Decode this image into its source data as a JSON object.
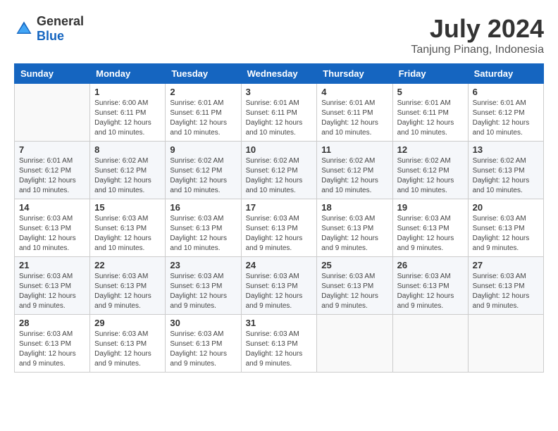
{
  "logo": {
    "text_general": "General",
    "text_blue": "Blue"
  },
  "title": "July 2024",
  "subtitle": "Tanjung Pinang, Indonesia",
  "days_of_week": [
    "Sunday",
    "Monday",
    "Tuesday",
    "Wednesday",
    "Thursday",
    "Friday",
    "Saturday"
  ],
  "weeks": [
    [
      {
        "day": "",
        "sunrise": "",
        "sunset": "",
        "daylight": ""
      },
      {
        "day": "1",
        "sunrise": "Sunrise: 6:00 AM",
        "sunset": "Sunset: 6:11 PM",
        "daylight": "Daylight: 12 hours and 10 minutes."
      },
      {
        "day": "2",
        "sunrise": "Sunrise: 6:01 AM",
        "sunset": "Sunset: 6:11 PM",
        "daylight": "Daylight: 12 hours and 10 minutes."
      },
      {
        "day": "3",
        "sunrise": "Sunrise: 6:01 AM",
        "sunset": "Sunset: 6:11 PM",
        "daylight": "Daylight: 12 hours and 10 minutes."
      },
      {
        "day": "4",
        "sunrise": "Sunrise: 6:01 AM",
        "sunset": "Sunset: 6:11 PM",
        "daylight": "Daylight: 12 hours and 10 minutes."
      },
      {
        "day": "5",
        "sunrise": "Sunrise: 6:01 AM",
        "sunset": "Sunset: 6:11 PM",
        "daylight": "Daylight: 12 hours and 10 minutes."
      },
      {
        "day": "6",
        "sunrise": "Sunrise: 6:01 AM",
        "sunset": "Sunset: 6:12 PM",
        "daylight": "Daylight: 12 hours and 10 minutes."
      }
    ],
    [
      {
        "day": "7",
        "sunrise": "Sunrise: 6:01 AM",
        "sunset": "Sunset: 6:12 PM",
        "daylight": "Daylight: 12 hours and 10 minutes."
      },
      {
        "day": "8",
        "sunrise": "Sunrise: 6:02 AM",
        "sunset": "Sunset: 6:12 PM",
        "daylight": "Daylight: 12 hours and 10 minutes."
      },
      {
        "day": "9",
        "sunrise": "Sunrise: 6:02 AM",
        "sunset": "Sunset: 6:12 PM",
        "daylight": "Daylight: 12 hours and 10 minutes."
      },
      {
        "day": "10",
        "sunrise": "Sunrise: 6:02 AM",
        "sunset": "Sunset: 6:12 PM",
        "daylight": "Daylight: 12 hours and 10 minutes."
      },
      {
        "day": "11",
        "sunrise": "Sunrise: 6:02 AM",
        "sunset": "Sunset: 6:12 PM",
        "daylight": "Daylight: 12 hours and 10 minutes."
      },
      {
        "day": "12",
        "sunrise": "Sunrise: 6:02 AM",
        "sunset": "Sunset: 6:12 PM",
        "daylight": "Daylight: 12 hours and 10 minutes."
      },
      {
        "day": "13",
        "sunrise": "Sunrise: 6:02 AM",
        "sunset": "Sunset: 6:13 PM",
        "daylight": "Daylight: 12 hours and 10 minutes."
      }
    ],
    [
      {
        "day": "14",
        "sunrise": "Sunrise: 6:03 AM",
        "sunset": "Sunset: 6:13 PM",
        "daylight": "Daylight: 12 hours and 10 minutes."
      },
      {
        "day": "15",
        "sunrise": "Sunrise: 6:03 AM",
        "sunset": "Sunset: 6:13 PM",
        "daylight": "Daylight: 12 hours and 10 minutes."
      },
      {
        "day": "16",
        "sunrise": "Sunrise: 6:03 AM",
        "sunset": "Sunset: 6:13 PM",
        "daylight": "Daylight: 12 hours and 10 minutes."
      },
      {
        "day": "17",
        "sunrise": "Sunrise: 6:03 AM",
        "sunset": "Sunset: 6:13 PM",
        "daylight": "Daylight: 12 hours and 9 minutes."
      },
      {
        "day": "18",
        "sunrise": "Sunrise: 6:03 AM",
        "sunset": "Sunset: 6:13 PM",
        "daylight": "Daylight: 12 hours and 9 minutes."
      },
      {
        "day": "19",
        "sunrise": "Sunrise: 6:03 AM",
        "sunset": "Sunset: 6:13 PM",
        "daylight": "Daylight: 12 hours and 9 minutes."
      },
      {
        "day": "20",
        "sunrise": "Sunrise: 6:03 AM",
        "sunset": "Sunset: 6:13 PM",
        "daylight": "Daylight: 12 hours and 9 minutes."
      }
    ],
    [
      {
        "day": "21",
        "sunrise": "Sunrise: 6:03 AM",
        "sunset": "Sunset: 6:13 PM",
        "daylight": "Daylight: 12 hours and 9 minutes."
      },
      {
        "day": "22",
        "sunrise": "Sunrise: 6:03 AM",
        "sunset": "Sunset: 6:13 PM",
        "daylight": "Daylight: 12 hours and 9 minutes."
      },
      {
        "day": "23",
        "sunrise": "Sunrise: 6:03 AM",
        "sunset": "Sunset: 6:13 PM",
        "daylight": "Daylight: 12 hours and 9 minutes."
      },
      {
        "day": "24",
        "sunrise": "Sunrise: 6:03 AM",
        "sunset": "Sunset: 6:13 PM",
        "daylight": "Daylight: 12 hours and 9 minutes."
      },
      {
        "day": "25",
        "sunrise": "Sunrise: 6:03 AM",
        "sunset": "Sunset: 6:13 PM",
        "daylight": "Daylight: 12 hours and 9 minutes."
      },
      {
        "day": "26",
        "sunrise": "Sunrise: 6:03 AM",
        "sunset": "Sunset: 6:13 PM",
        "daylight": "Daylight: 12 hours and 9 minutes."
      },
      {
        "day": "27",
        "sunrise": "Sunrise: 6:03 AM",
        "sunset": "Sunset: 6:13 PM",
        "daylight": "Daylight: 12 hours and 9 minutes."
      }
    ],
    [
      {
        "day": "28",
        "sunrise": "Sunrise: 6:03 AM",
        "sunset": "Sunset: 6:13 PM",
        "daylight": "Daylight: 12 hours and 9 minutes."
      },
      {
        "day": "29",
        "sunrise": "Sunrise: 6:03 AM",
        "sunset": "Sunset: 6:13 PM",
        "daylight": "Daylight: 12 hours and 9 minutes."
      },
      {
        "day": "30",
        "sunrise": "Sunrise: 6:03 AM",
        "sunset": "Sunset: 6:13 PM",
        "daylight": "Daylight: 12 hours and 9 minutes."
      },
      {
        "day": "31",
        "sunrise": "Sunrise: 6:03 AM",
        "sunset": "Sunset: 6:13 PM",
        "daylight": "Daylight: 12 hours and 9 minutes."
      },
      {
        "day": "",
        "sunrise": "",
        "sunset": "",
        "daylight": ""
      },
      {
        "day": "",
        "sunrise": "",
        "sunset": "",
        "daylight": ""
      },
      {
        "day": "",
        "sunrise": "",
        "sunset": "",
        "daylight": ""
      }
    ]
  ]
}
